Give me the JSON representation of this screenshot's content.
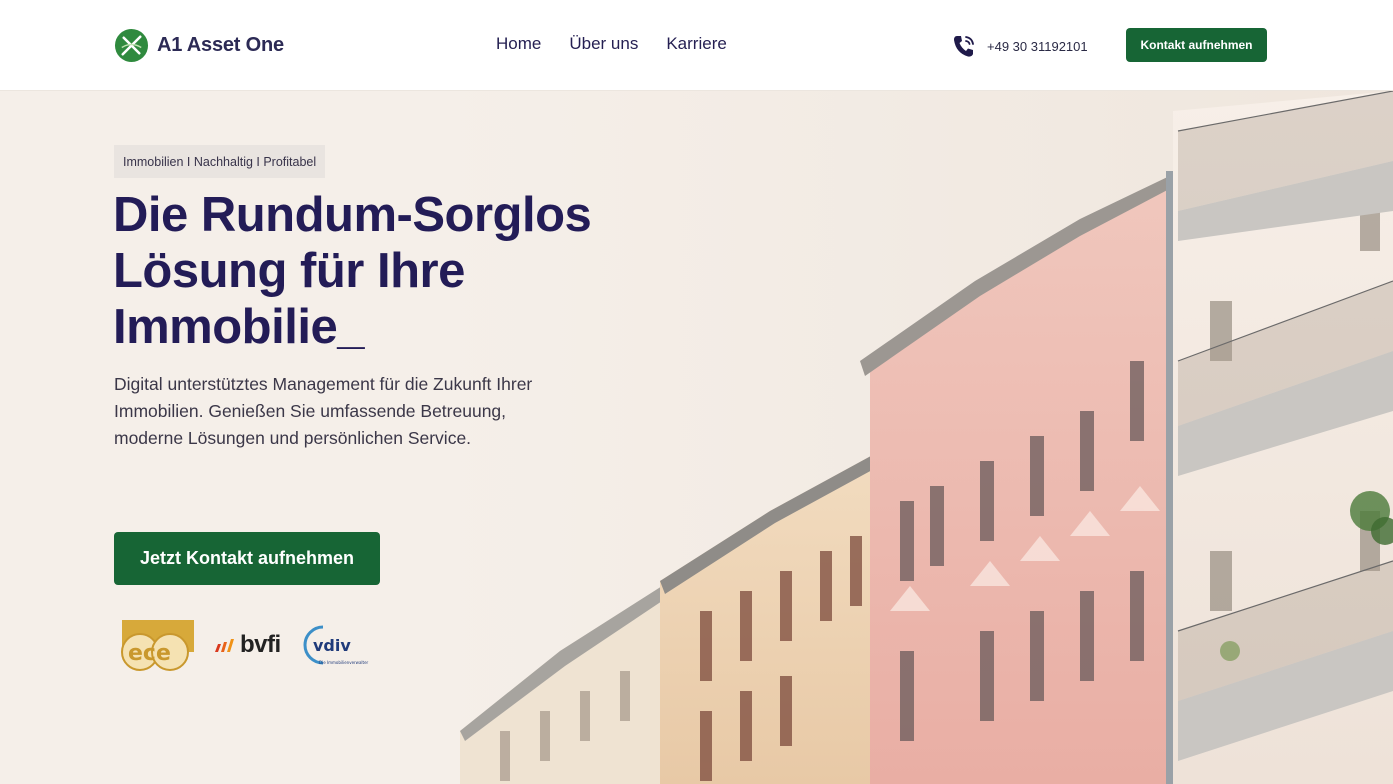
{
  "header": {
    "brand": "A1 Asset One",
    "nav": [
      "Home",
      "Über uns",
      "Karriere"
    ],
    "phone": "+49 30 31192101",
    "cta": "Kontakt aufnehmen",
    "icons": {
      "logo": "a1-logo-icon",
      "phone": "phone-icon"
    }
  },
  "hero": {
    "tagline": "Immobilien I Nachhaltig I Profitabel",
    "headline_lines": [
      "Die Rundum-Sorglos",
      "Lösung für Ihre",
      "Immobilie"
    ],
    "cursor": "_",
    "lead": "Digital unterstütztes Management für die Zukunft Ihrer Immobilien. Genießen Sie umfassende Betreuung, moderne Lösungen und persönlichen Service.",
    "cta": "Jetzt Kontakt aufnehmen"
  },
  "badges": {
    "ece_label": "ece",
    "bvfi_label": "bvfi",
    "vdiv_label": "vdiv",
    "vdiv_sub": "Die Immobilienverwalter"
  },
  "colors": {
    "primary_green": "#176535",
    "headline_navy": "#231c57",
    "background": "#f5efe9"
  }
}
